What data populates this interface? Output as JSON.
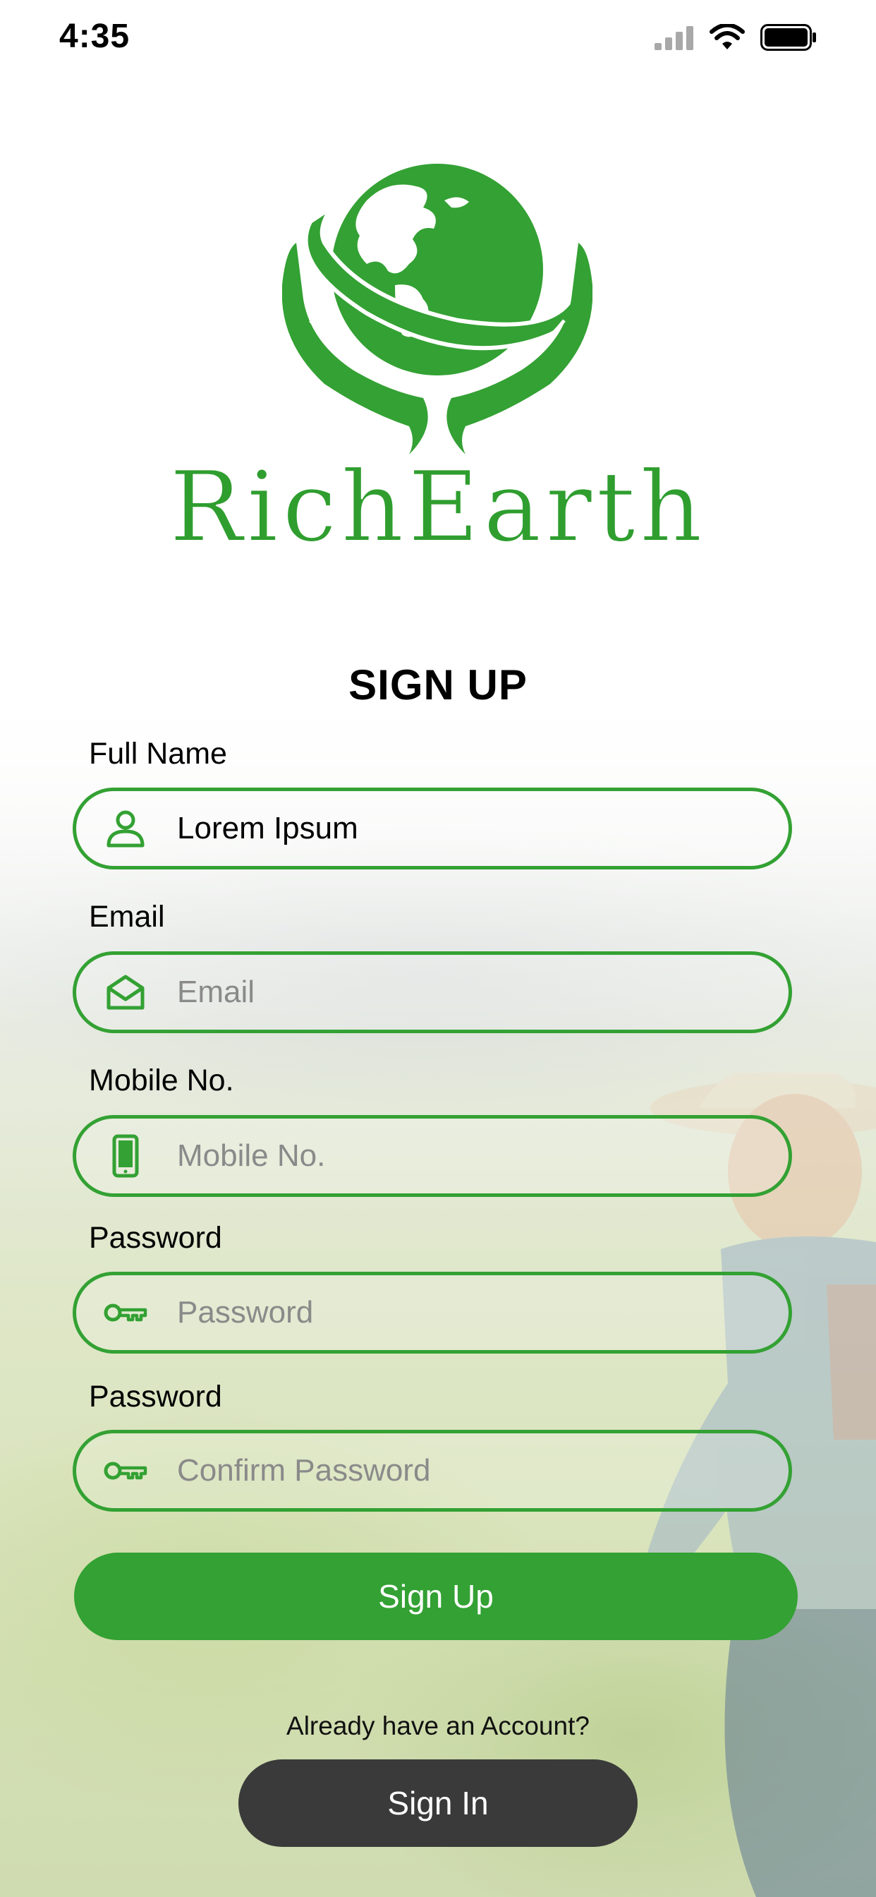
{
  "status_bar": {
    "time": "4:35"
  },
  "brand": {
    "name": "RichEarth",
    "color": "#33a133"
  },
  "form": {
    "title": "SIGN UP",
    "fields": [
      {
        "label": "Full Name",
        "value": "Lorem Ipsum",
        "placeholder": "",
        "icon": "user-icon"
      },
      {
        "label": "Email",
        "value": "",
        "placeholder": "Email",
        "icon": "envelope-icon"
      },
      {
        "label": "Mobile No.",
        "value": "",
        "placeholder": "Mobile No.",
        "icon": "phone-icon"
      },
      {
        "label": "Password",
        "value": "",
        "placeholder": "Password",
        "icon": "key-icon"
      },
      {
        "label": "Password",
        "value": "",
        "placeholder": "Confirm Password",
        "icon": "key-icon"
      }
    ],
    "signup_label": "Sign Up",
    "already_text": "Already have an Account?",
    "signin_label": "Sign In"
  },
  "colors": {
    "accent": "#33a133",
    "dark_button": "#3a3a3a"
  }
}
